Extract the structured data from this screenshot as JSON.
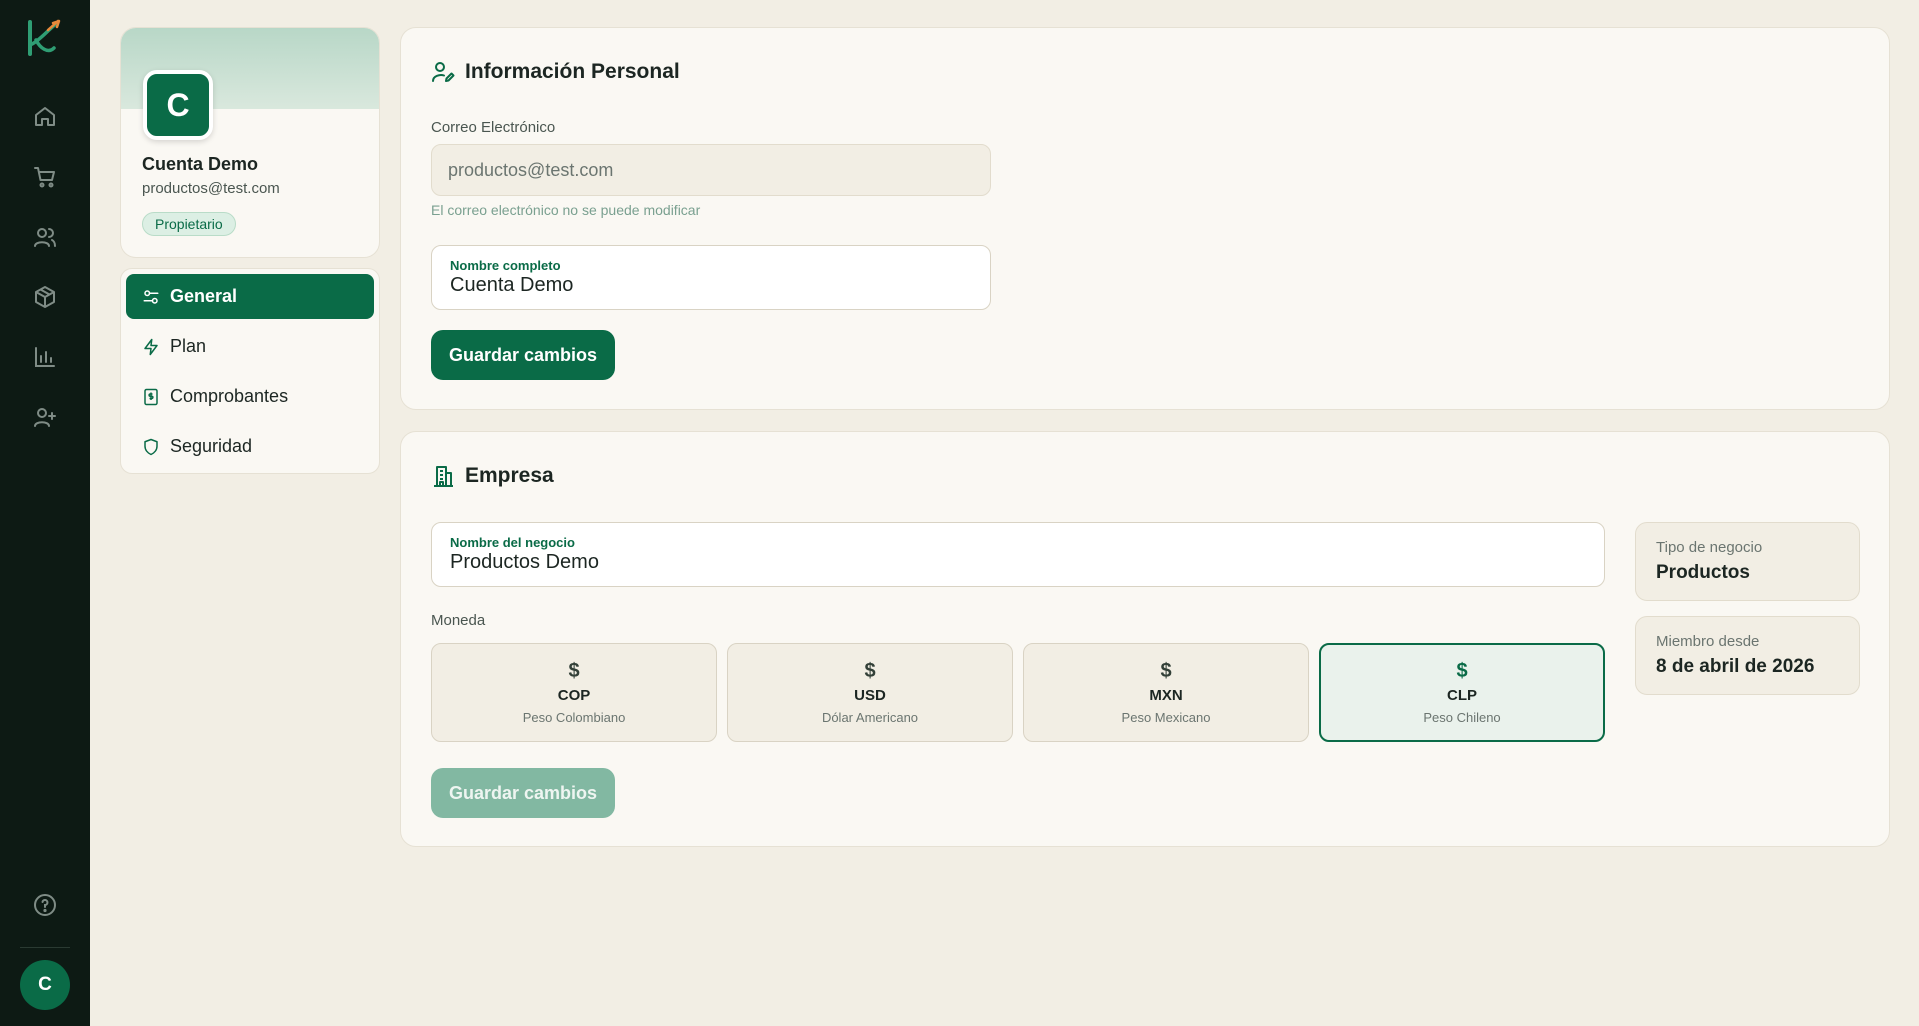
{
  "rail": {
    "avatar_initial": "C",
    "nav": [
      "home-icon",
      "cart-icon",
      "users-icon",
      "box-icon",
      "bar-chart-icon",
      "user-plus-icon",
      "help-icon"
    ]
  },
  "profile": {
    "initial": "C",
    "name": "Cuenta Demo",
    "email": "productos@test.com",
    "role": "Propietario"
  },
  "settings_nav": {
    "items": [
      {
        "label": "General",
        "icon": "sliders-icon",
        "active": true
      },
      {
        "label": "Plan",
        "icon": "bolt-icon",
        "active": false
      },
      {
        "label": "Comprobantes",
        "icon": "receipt-icon",
        "active": false
      },
      {
        "label": "Seguridad",
        "icon": "shield-icon",
        "active": false
      }
    ]
  },
  "personal": {
    "title": "Información Personal",
    "email_label": "Correo Electrónico",
    "email_value": "productos@test.com",
    "email_hint": "El correo electrónico no se puede modificar",
    "fullname_label": "Nombre completo",
    "fullname_value": "Cuenta Demo",
    "save_label": "Guardar cambios"
  },
  "empresa": {
    "title": "Empresa",
    "business_name_label": "Nombre del negocio",
    "business_name_value": "Productos Demo",
    "currency_label": "Moneda",
    "currencies": [
      {
        "symbol": "$",
        "code": "COP",
        "name": "Peso Colombiano",
        "selected": false
      },
      {
        "symbol": "$",
        "code": "USD",
        "name": "Dólar Americano",
        "selected": false
      },
      {
        "symbol": "$",
        "code": "MXN",
        "name": "Peso Mexicano",
        "selected": false
      },
      {
        "symbol": "$",
        "code": "CLP",
        "name": "Peso Chileno",
        "selected": true
      }
    ],
    "business_type_label": "Tipo de negocio",
    "business_type_value": "Productos",
    "member_since_label": "Miembro desde",
    "member_since_value": "8 de abril de 2026",
    "save_label": "Guardar cambios",
    "save_disabled": true
  },
  "colors": {
    "accent": "#0a6b47",
    "rail_bg": "#0d1a14",
    "page_bg": "#f2eee4",
    "logo_orange": "#e8893a"
  }
}
